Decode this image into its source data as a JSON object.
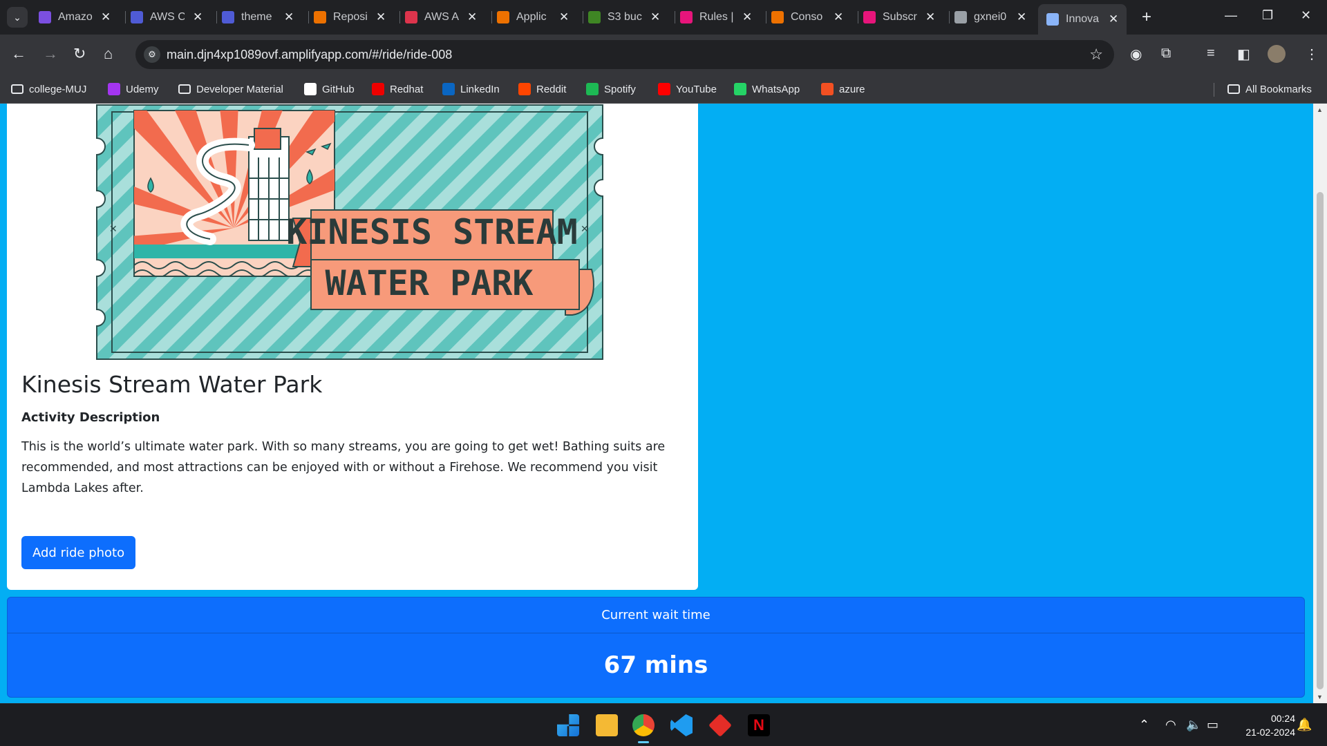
{
  "browser": {
    "tabs": [
      {
        "title": "Amazon",
        "color": "#7b4fe0"
      },
      {
        "title": "AWS C",
        "color": "#4f5bd5"
      },
      {
        "title": "theme",
        "color": "#4f5bd5"
      },
      {
        "title": "Reposi",
        "color": "#ed7100"
      },
      {
        "title": "AWS A",
        "color": "#dd344c"
      },
      {
        "title": "Applic",
        "color": "#ed7100"
      },
      {
        "title": "S3 buc",
        "color": "#3f8624"
      },
      {
        "title": "Rules |",
        "color": "#e7157b"
      },
      {
        "title": "Conso",
        "color": "#ed7100"
      },
      {
        "title": "Subscr",
        "color": "#e7157b"
      },
      {
        "title": "gxnei0",
        "color": "#9aa0a6"
      },
      {
        "title": "Innova",
        "color": "#8ab4f8"
      }
    ],
    "close_glyph": "✕",
    "new_tab_glyph": "+",
    "url": "main.djn4xp1089ovf.amplifyapp.com/#/ride/ride-008",
    "bookmarks": [
      {
        "label": "college-MUJ",
        "icon": "folder-icon",
        "color": "#e8eaed"
      },
      {
        "label": "Udemy",
        "icon": "udemy-icon",
        "color": "#a435f0"
      },
      {
        "label": "Developer Material",
        "icon": "folder-icon",
        "color": "#e8eaed"
      },
      {
        "label": "GitHub",
        "icon": "github-icon",
        "color": "#ffffff"
      },
      {
        "label": "Redhat",
        "icon": "redhat-icon",
        "color": "#ee0000"
      },
      {
        "label": "LinkedIn",
        "icon": "linkedin-icon",
        "color": "#0a66c2"
      },
      {
        "label": "Reddit",
        "icon": "reddit-icon",
        "color": "#ff4500"
      },
      {
        "label": "Spotify",
        "icon": "spotify-icon",
        "color": "#1db954"
      },
      {
        "label": "YouTube",
        "icon": "youtube-icon",
        "color": "#ff0000"
      },
      {
        "label": "WhatsApp",
        "icon": "whatsapp-icon",
        "color": "#25d366"
      },
      {
        "label": "azure",
        "icon": "azure-icon",
        "color": "#f25022"
      }
    ],
    "all_bookmarks": "All Bookmarks"
  },
  "page": {
    "background": "#03aef3",
    "ticket": {
      "line1": "KINESIS STREAM",
      "line2": "WATER PARK"
    },
    "ride_title": "Kinesis Stream Water Park",
    "description_heading": "Activity Description",
    "description": "This is the world’s ultimate water park. With so many streams, you are going to get wet! Bathing suits are recommended, and most attractions can be enjoyed with or without a Firehose. We recommend you visit Lambda Lakes after.",
    "add_photo_button": "Add ride photo",
    "wait_time_label": "Current wait time",
    "wait_time_value": "67 mins",
    "accent": "#0d6efd"
  },
  "taskbar": {
    "time": "00:24",
    "date": "21-02-2024"
  }
}
